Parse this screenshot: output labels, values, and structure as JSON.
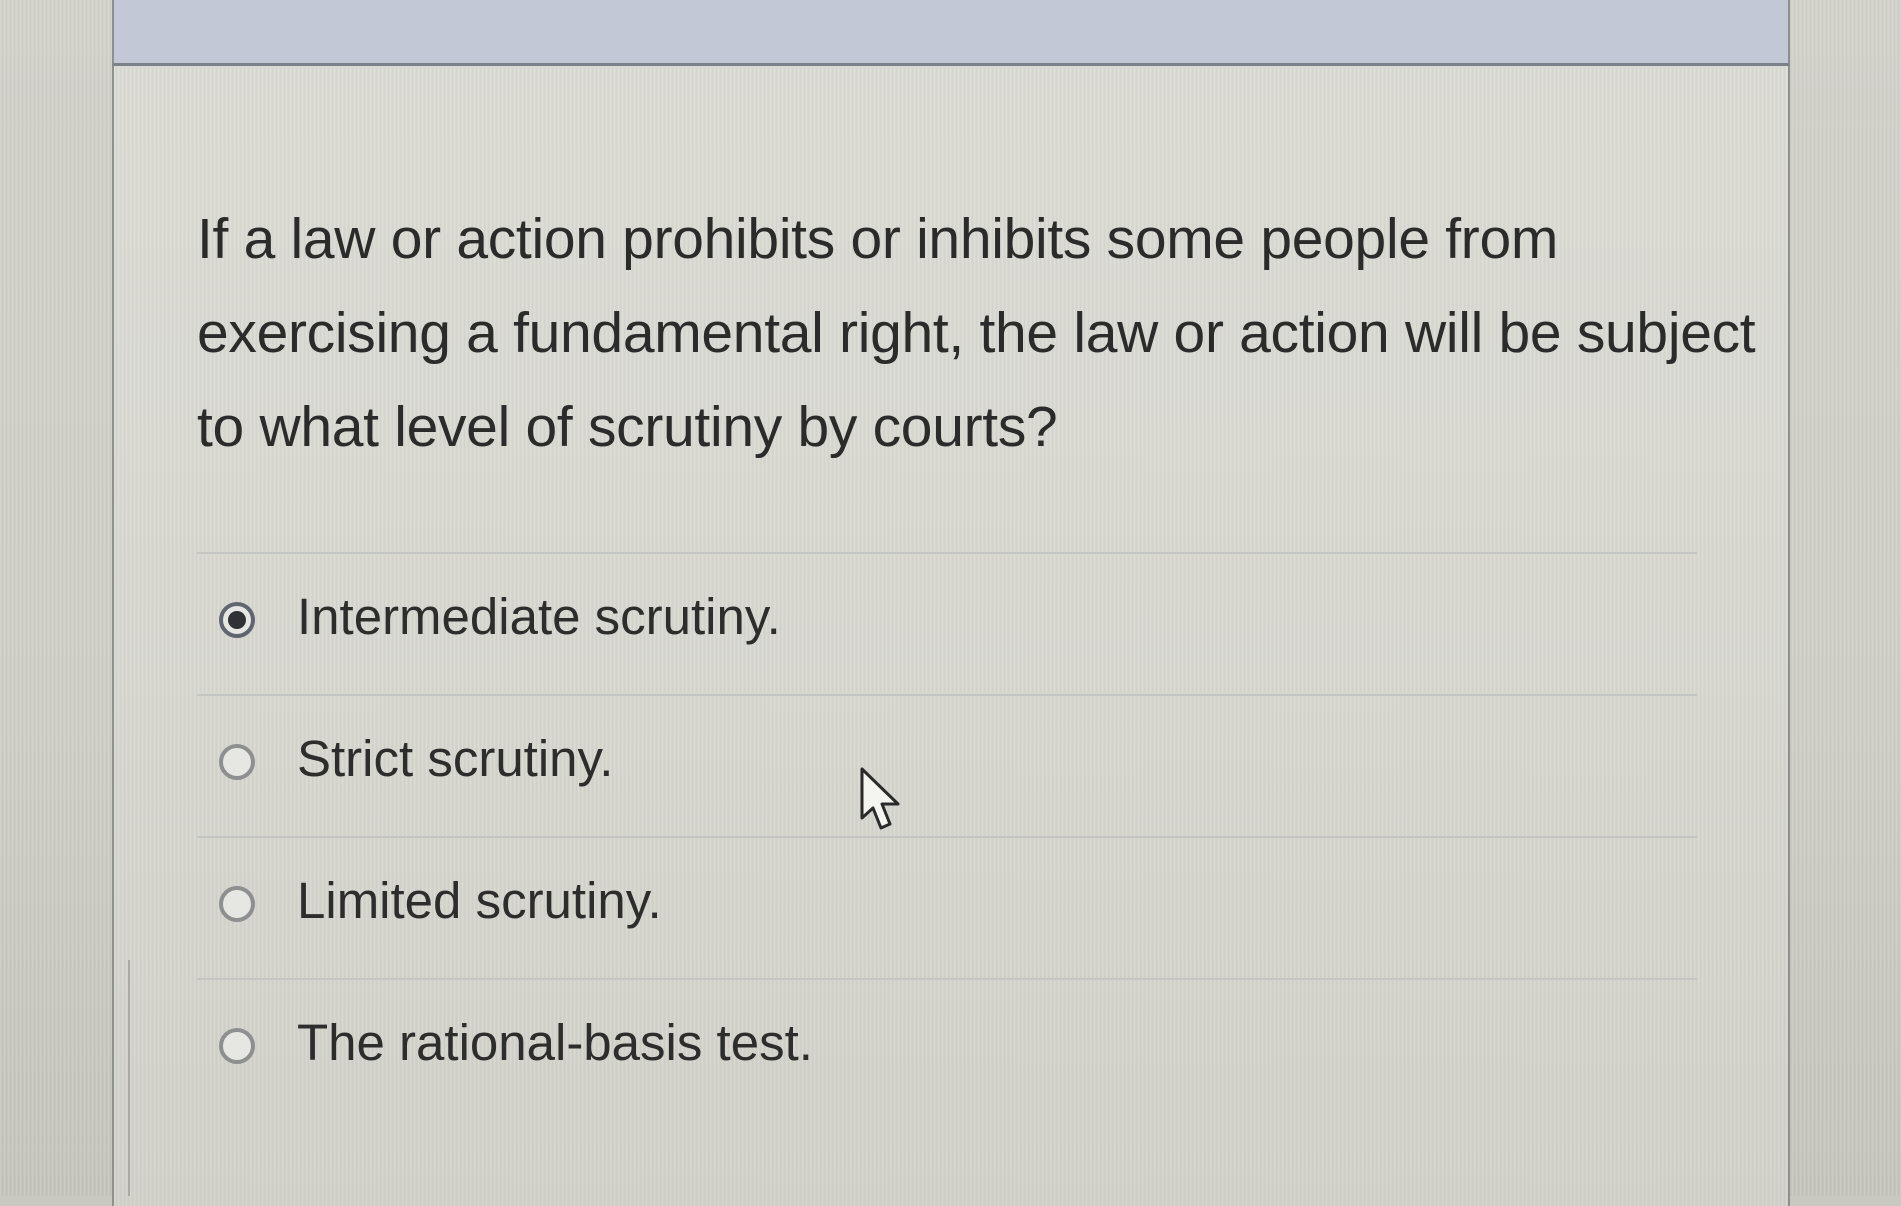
{
  "question": {
    "text": "If a law or action prohibits or inhibits some people from exercising a fundamental right, the law or action will be subject to what level of scrutiny by courts?"
  },
  "options": [
    {
      "label": "Intermediate scrutiny.",
      "selected": true
    },
    {
      "label": "Strict scrutiny.",
      "selected": false
    },
    {
      "label": "Limited scrutiny.",
      "selected": false
    },
    {
      "label": "The rational-basis test.",
      "selected": false
    }
  ],
  "cursor_icon": "pointer-arrow-icon",
  "colors": {
    "header_bar": "#c3c8d6",
    "card_background": "#d8d8d1",
    "text": "#2b2b2b",
    "radio_selected": "#2f3136"
  }
}
